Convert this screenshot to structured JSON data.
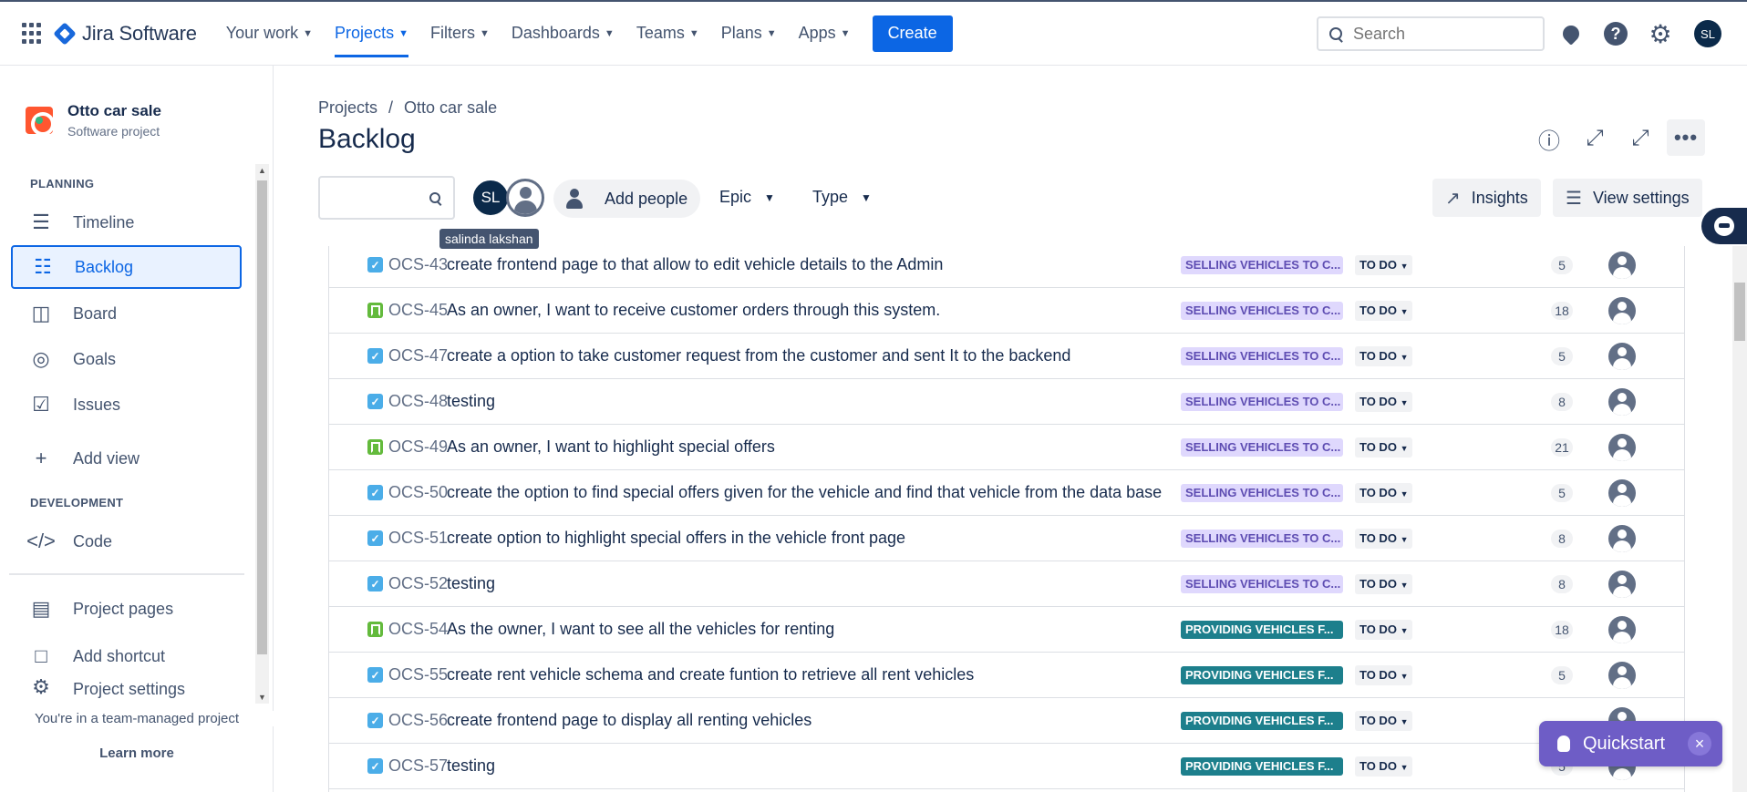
{
  "topnav": {
    "app_name": "Jira Software",
    "items": [
      {
        "label": "Your work"
      },
      {
        "label": "Projects"
      },
      {
        "label": "Filters"
      },
      {
        "label": "Dashboards"
      },
      {
        "label": "Teams"
      },
      {
        "label": "Plans"
      },
      {
        "label": "Apps"
      }
    ],
    "active_item": "Projects",
    "create_label": "Create",
    "search_placeholder": "Search",
    "user_initials": "SL"
  },
  "sidebar": {
    "project_name": "Otto car sale",
    "project_type": "Software project",
    "planning_label": "PLANNING",
    "planning_items": [
      {
        "label": "Timeline",
        "icon": "timeline-icon"
      },
      {
        "label": "Backlog",
        "icon": "backlog-icon"
      },
      {
        "label": "Board",
        "icon": "board-icon"
      },
      {
        "label": "Goals",
        "icon": "goals-icon"
      },
      {
        "label": "Issues",
        "icon": "issues-icon"
      }
    ],
    "active_item": "Backlog",
    "add_view_label": "Add view",
    "development_label": "DEVELOPMENT",
    "code_label": "Code",
    "project_pages_label": "Project pages",
    "add_shortcut_label": "Add shortcut",
    "project_settings_label": "Project settings",
    "team_note": "You're in a team-managed project",
    "learn_more": "Learn more"
  },
  "header": {
    "breadcrumb": [
      "Projects",
      "Otto car sale"
    ],
    "title": "Backlog"
  },
  "toolbar": {
    "avatar_initials": "SL",
    "tooltip": "salinda lakshan",
    "add_people_label": "Add people",
    "epic_label": "Epic",
    "type_label": "Type",
    "insights_label": "Insights",
    "view_settings_label": "View settings"
  },
  "issues": [
    {
      "key": "OCS-43",
      "type": "task",
      "summary": "create frontend page to that allow to edit vehicle details to the Admin",
      "epic": "SELLING VEHICLES TO C...",
      "epic_color": "purple",
      "status": "TO DO",
      "points": "5"
    },
    {
      "key": "OCS-45",
      "type": "story",
      "summary": "As an owner, I want to receive customer orders through this system.",
      "epic": "SELLING VEHICLES TO C...",
      "epic_color": "purple",
      "status": "TO DO",
      "points": "18"
    },
    {
      "key": "OCS-47",
      "type": "task",
      "summary": "create a option to take customer request from the customer and sent It to the backend",
      "epic": "SELLING VEHICLES TO C...",
      "epic_color": "purple",
      "status": "TO DO",
      "points": "5"
    },
    {
      "key": "OCS-48",
      "type": "task",
      "summary": "testing",
      "epic": "SELLING VEHICLES TO C...",
      "epic_color": "purple",
      "status": "TO DO",
      "points": "8"
    },
    {
      "key": "OCS-49",
      "type": "story",
      "summary": "As an owner, I want to highlight special offers",
      "epic": "SELLING VEHICLES TO C...",
      "epic_color": "purple",
      "status": "TO DO",
      "points": "21"
    },
    {
      "key": "OCS-50",
      "type": "task",
      "summary": "create the option to find special offers given for the vehicle and find that vehicle from the data base",
      "epic": "SELLING VEHICLES TO C...",
      "epic_color": "purple",
      "status": "TO DO",
      "points": "5"
    },
    {
      "key": "OCS-51",
      "type": "task",
      "summary": "create option to highlight special offers in the vehicle front page",
      "epic": "SELLING VEHICLES TO C...",
      "epic_color": "purple",
      "status": "TO DO",
      "points": "8"
    },
    {
      "key": "OCS-52",
      "type": "task",
      "summary": "testing",
      "epic": "SELLING VEHICLES TO C...",
      "epic_color": "purple",
      "status": "TO DO",
      "points": "8"
    },
    {
      "key": "OCS-54",
      "type": "story",
      "summary": "As the owner, I want to see all the vehicles for renting",
      "epic": "PROVIDING VEHICLES F...",
      "epic_color": "teal",
      "status": "TO DO",
      "points": "18"
    },
    {
      "key": "OCS-55",
      "type": "task",
      "summary": "create rent vehicle schema and create funtion to retrieve all rent vehicles",
      "epic": "PROVIDING VEHICLES F...",
      "epic_color": "teal",
      "status": "TO DO",
      "points": "5"
    },
    {
      "key": "OCS-56",
      "type": "task",
      "summary": "create frontend page to display all renting vehicles",
      "epic": "PROVIDING VEHICLES F...",
      "epic_color": "teal",
      "status": "TO DO",
      "points": ""
    },
    {
      "key": "OCS-57",
      "type": "task",
      "summary": "testing",
      "epic": "PROVIDING VEHICLES F...",
      "epic_color": "teal",
      "status": "TO DO",
      "points": "5"
    }
  ],
  "quickstart": {
    "label": "Quickstart"
  }
}
